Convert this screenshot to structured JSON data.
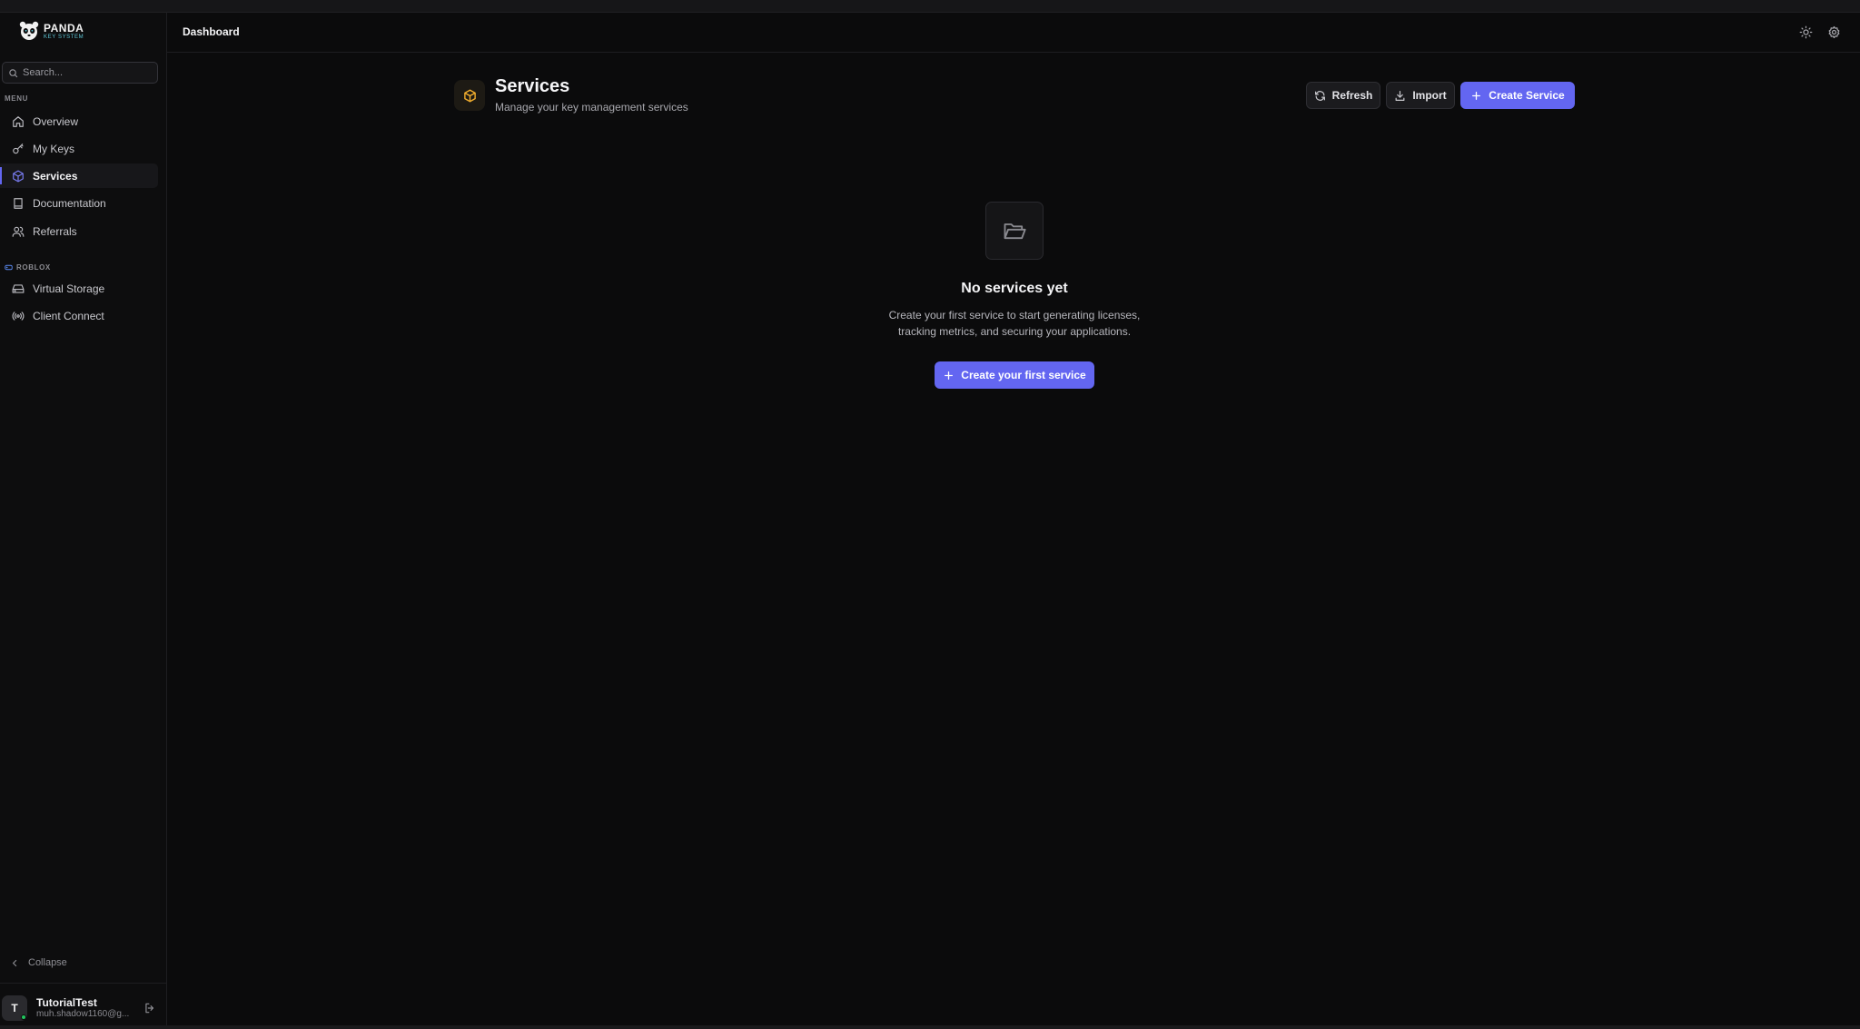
{
  "logo": {
    "line1": "PANDA",
    "line2": "KEY SYSTEM"
  },
  "search": {
    "placeholder": "Search..."
  },
  "sidebar": {
    "menu_label": "MENU",
    "items": [
      {
        "label": "Overview",
        "icon": "home-icon",
        "active": false
      },
      {
        "label": "My Keys",
        "icon": "key-icon",
        "active": false
      },
      {
        "label": "Services",
        "icon": "cube-icon",
        "active": true
      },
      {
        "label": "Documentation",
        "icon": "book-icon",
        "active": false
      },
      {
        "label": "Referrals",
        "icon": "users-icon",
        "active": false
      }
    ],
    "roblox_label": "ROBLOX",
    "roblox_items": [
      {
        "label": "Virtual Storage",
        "icon": "hard-drive-icon"
      },
      {
        "label": "Client Connect",
        "icon": "broadcast-icon"
      }
    ],
    "collapse_label": "Collapse"
  },
  "user": {
    "initial": "T",
    "name": "TutorialTest",
    "email": "muh.shadow1160@g..."
  },
  "header": {
    "title": "Dashboard"
  },
  "page": {
    "title": "Services",
    "subtitle": "Manage your key management services",
    "refresh_label": "Refresh",
    "import_label": "Import",
    "create_label": "Create Service"
  },
  "empty_state": {
    "title": "No services yet",
    "line1": "Create your first service to start generating licenses,",
    "line2": "tracking metrics, and securing your applications.",
    "button_label": "Create your first service"
  },
  "colors": {
    "accent": "#6366f1",
    "service_icon": "#f5b02e",
    "online": "#22c55e"
  }
}
